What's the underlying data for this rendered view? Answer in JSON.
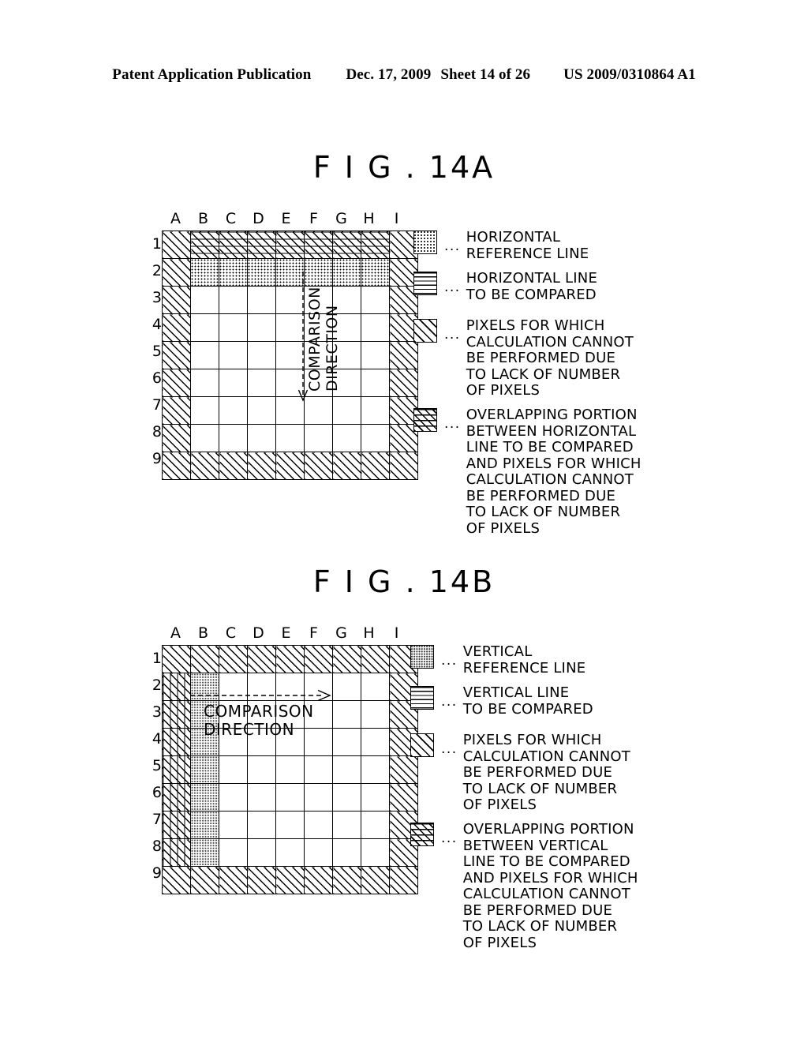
{
  "header": {
    "publication": "Patent Application Publication",
    "date": "Dec. 17, 2009",
    "sheet": "Sheet 14 of 26",
    "patent_number": "US 2009/0310864 A1"
  },
  "figures": [
    {
      "id": "fig-14a",
      "title": "F I G . 14A",
      "grid": {
        "columns": [
          "A",
          "B",
          "C",
          "D",
          "E",
          "F",
          "G",
          "H",
          "I"
        ],
        "rows": [
          "1",
          "2",
          "3",
          "4",
          "5",
          "6",
          "7",
          "8",
          "9"
        ],
        "cells": [
          [
            "hatch",
            "overlap-h",
            "overlap-h",
            "overlap-h",
            "overlap-h",
            "overlap-h",
            "overlap-h",
            "overlap-h",
            "hatch"
          ],
          [
            "hatch",
            "dots",
            "dots",
            "dots",
            "dots",
            "dots",
            "dots",
            "dots",
            "hatch"
          ],
          [
            "hatch",
            "blank",
            "blank",
            "blank",
            "blank",
            "blank",
            "blank",
            "blank",
            "hatch"
          ],
          [
            "hatch",
            "blank",
            "blank",
            "blank",
            "blank",
            "blank",
            "blank",
            "blank",
            "hatch"
          ],
          [
            "hatch",
            "blank",
            "blank",
            "blank",
            "blank",
            "blank",
            "blank",
            "blank",
            "hatch"
          ],
          [
            "hatch",
            "blank",
            "blank",
            "blank",
            "blank",
            "blank",
            "blank",
            "blank",
            "hatch"
          ],
          [
            "hatch",
            "blank",
            "blank",
            "blank",
            "blank",
            "blank",
            "blank",
            "blank",
            "hatch"
          ],
          [
            "hatch",
            "blank",
            "blank",
            "blank",
            "blank",
            "blank",
            "blank",
            "blank",
            "hatch"
          ],
          [
            "hatch",
            "hatch",
            "hatch",
            "hatch",
            "hatch",
            "hatch",
            "hatch",
            "hatch",
            "hatch"
          ]
        ]
      },
      "annotation": {
        "line1": "COMPARISON",
        "line2": "DIRECTION",
        "orientation": "vertical-down"
      },
      "legend": [
        {
          "swatch": "dots",
          "separator": "...",
          "text": "HORIZONTAL\nREFERENCE LINE"
        },
        {
          "swatch": "hlines",
          "separator": "...",
          "text": "HORIZONTAL LINE\nTO BE COMPARED"
        },
        {
          "swatch": "hatch",
          "separator": "...",
          "text": "PIXELS FOR WHICH\nCALCULATION CANNOT\nBE PERFORMED DUE\nTO LACK OF NUMBER\nOF PIXELS"
        },
        {
          "swatch": "overlap",
          "separator": "...",
          "text": "OVERLAPPING PORTION\nBETWEEN HORIZONTAL\nLINE TO BE COMPARED\nAND PIXELS FOR WHICH\n CALCULATION CANNOT\nBE PERFORMED DUE\nTO LACK OF NUMBER\nOF PIXELS"
        }
      ]
    },
    {
      "id": "fig-14b",
      "title": "F I G . 14B",
      "grid": {
        "columns": [
          "A",
          "B",
          "C",
          "D",
          "E",
          "F",
          "G",
          "H",
          "I"
        ],
        "rows": [
          "1",
          "2",
          "3",
          "4",
          "5",
          "6",
          "7",
          "8",
          "9"
        ],
        "cells": [
          [
            "hatch",
            "hatch",
            "hatch",
            "hatch",
            "hatch",
            "hatch",
            "hatch",
            "hatch",
            "hatch"
          ],
          [
            "overlap-v",
            "dots-v",
            "blank",
            "blank",
            "blank",
            "blank",
            "blank",
            "blank",
            "hatch"
          ],
          [
            "overlap-v",
            "dots-v",
            "blank",
            "blank",
            "blank",
            "blank",
            "blank",
            "blank",
            "hatch"
          ],
          [
            "overlap-v",
            "dots-v",
            "blank",
            "blank",
            "blank",
            "blank",
            "blank",
            "blank",
            "hatch"
          ],
          [
            "overlap-v",
            "dots-v",
            "blank",
            "blank",
            "blank",
            "blank",
            "blank",
            "blank",
            "hatch"
          ],
          [
            "overlap-v",
            "dots-v",
            "blank",
            "blank",
            "blank",
            "blank",
            "blank",
            "blank",
            "hatch"
          ],
          [
            "overlap-v",
            "dots-v",
            "blank",
            "blank",
            "blank",
            "blank",
            "blank",
            "blank",
            "hatch"
          ],
          [
            "overlap-v",
            "dots-v",
            "blank",
            "blank",
            "blank",
            "blank",
            "blank",
            "blank",
            "hatch"
          ],
          [
            "hatch",
            "hatch",
            "hatch",
            "hatch",
            "hatch",
            "hatch",
            "hatch",
            "hatch",
            "hatch"
          ]
        ]
      },
      "annotation": {
        "line1": "COMPARISON",
        "line2": "DIRECTION",
        "orientation": "horizontal-right"
      },
      "legend": [
        {
          "swatch": "dots-v",
          "separator": "...",
          "text": "VERTICAL\nREFERENCE LINE"
        },
        {
          "swatch": "hlines",
          "separator": "...",
          "text": "VERTICAL LINE\nTO BE COMPARED"
        },
        {
          "swatch": "hatch",
          "separator": "...",
          "text": "PIXELS FOR WHICH\nCALCULATION CANNOT\nBE PERFORMED DUE\nTO LACK OF NUMBER\nOF PIXELS"
        },
        {
          "swatch": "overlap",
          "separator": "...",
          "text": "OVERLAPPING PORTION\nBETWEEN VERTICAL\nLINE TO BE COMPARED\nAND PIXELS FOR WHICH\n CALCULATION CANNOT\nBE PERFORMED DUE\nTO LACK OF NUMBER\nOF PIXELS"
        }
      ]
    }
  ]
}
